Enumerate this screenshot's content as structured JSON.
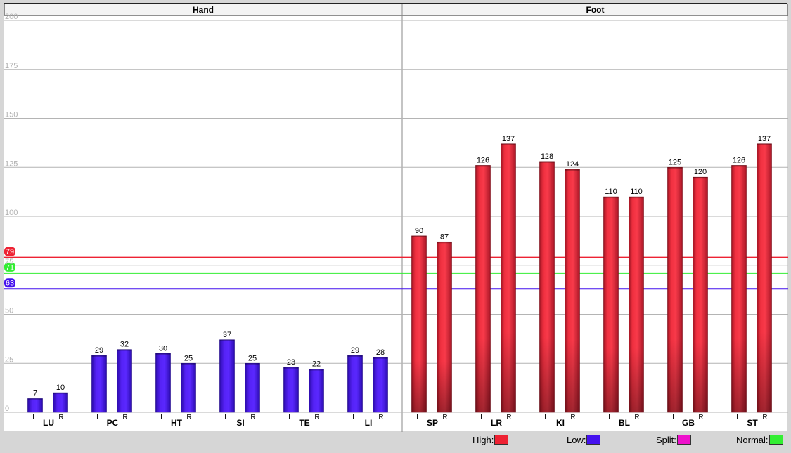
{
  "chart_data": {
    "type": "bar",
    "panels": [
      {
        "name": "Hand",
        "groups": [
          "LU",
          "PC",
          "HT",
          "SI",
          "TE",
          "LI"
        ]
      },
      {
        "name": "Foot",
        "groups": [
          "SP",
          "LR",
          "KI",
          "BL",
          "GB",
          "ST"
        ]
      }
    ],
    "bar_sides": [
      "L",
      "R"
    ],
    "values": [
      {
        "group": "LU",
        "L": 7,
        "R": 10,
        "status": "low"
      },
      {
        "group": "PC",
        "L": 29,
        "R": 32,
        "status": "low"
      },
      {
        "group": "HT",
        "L": 30,
        "R": 25,
        "status": "low"
      },
      {
        "group": "SI",
        "L": 37,
        "R": 25,
        "status": "low"
      },
      {
        "group": "TE",
        "L": 23,
        "R": 22,
        "status": "low"
      },
      {
        "group": "LI",
        "L": 29,
        "R": 28,
        "status": "low"
      },
      {
        "group": "SP",
        "L": 90,
        "R": 87,
        "status": "high"
      },
      {
        "group": "LR",
        "L": 126,
        "R": 137,
        "status": "high"
      },
      {
        "group": "KI",
        "L": 128,
        "R": 124,
        "status": "high"
      },
      {
        "group": "BL",
        "L": 110,
        "R": 110,
        "status": "high"
      },
      {
        "group": "GB",
        "L": 125,
        "R": 120,
        "status": "high"
      },
      {
        "group": "ST",
        "L": 126,
        "R": 137,
        "status": "high"
      }
    ],
    "ylim": [
      0,
      200
    ],
    "yticks": [
      0,
      25,
      50,
      75,
      100,
      125,
      150,
      175,
      200
    ],
    "grid": true,
    "reference_lines": [
      {
        "label": "79",
        "value": 79,
        "kind": "high"
      },
      {
        "label": "71",
        "value": 71,
        "kind": "normal"
      },
      {
        "label": "63",
        "value": 63,
        "kind": "low"
      }
    ],
    "legend": {
      "placement": "bottom",
      "items": [
        {
          "label": "High:",
          "color": "#ee2233"
        },
        {
          "label": "Low:",
          "color": "#4411ee"
        },
        {
          "label": "Split:",
          "color": "#ee11cc"
        },
        {
          "label": "Normal:",
          "color": "#33ee33"
        }
      ]
    },
    "colors": {
      "high": "#ee2233",
      "low": "#4411ee",
      "normal": "#33ee33"
    }
  }
}
